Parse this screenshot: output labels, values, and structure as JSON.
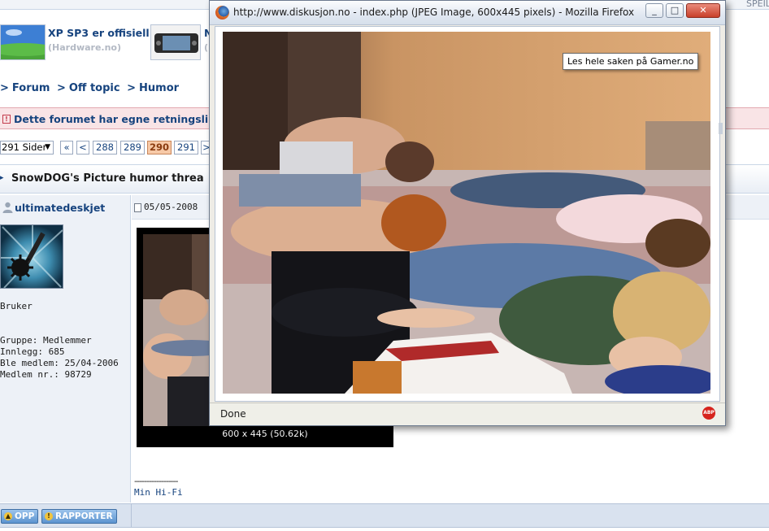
{
  "forum": {
    "top_strip": {
      "right_fragment": "SPEIL"
    },
    "news": [
      {
        "title": "XP SP3 er offisiell",
        "source": "(Hardware.no)"
      },
      {
        "title": "N",
        "source": "("
      }
    ],
    "breadcrumb": {
      "items": [
        "Forum",
        "Off topic",
        "Humor"
      ],
      "separator": ">"
    },
    "rules_notice": "Dette forumet har egne retningslinje",
    "pager": {
      "pages_select": "291 Sider",
      "first": "«",
      "prev": "<",
      "pages": [
        "288",
        "289",
        "290",
        "291"
      ],
      "current": "290",
      "next": ">"
    },
    "thread_title": "SnowDOG's Picture humor threa",
    "post": {
      "username": "ultimatedeskjet",
      "date": "05/05-2008 ",
      "user_title": "Bruker",
      "group": "Gruppe: Medlemmer",
      "posts": "Innlegg: 685",
      "joined": "Ble medlem: 25/04-2006",
      "member_no": "Medlem nr.: 98729",
      "image_caption": "600 x 445 (50.62k)",
      "signature_line": "------------------",
      "signature": "Min Hi-Fi"
    },
    "footer_buttons": {
      "up": "OPP",
      "report": "RAPPORTER"
    }
  },
  "popup": {
    "window_title": "http://www.diskusjon.no - index.php (JPEG Image, 600x445 pixels) - Mozilla Firefox",
    "tooltip": "Les hele saken på Gamer.no",
    "status": "Done",
    "abp_label": "ABP",
    "buttons": {
      "minimize": "_",
      "maximize": "□",
      "close": "✕"
    }
  },
  "colors": {
    "link_blue": "#16437e",
    "rules_bg": "#f9e4e6",
    "current_page_bg": "#f7c9a7",
    "button_blue": "#5c93cf"
  },
  "icons": [
    "firefox-icon",
    "minimize-icon",
    "maximize-icon",
    "close-icon",
    "user-icon",
    "post-document-icon",
    "notice-icon",
    "up-arrow-icon",
    "report-icon",
    "adblock-icon"
  ]
}
